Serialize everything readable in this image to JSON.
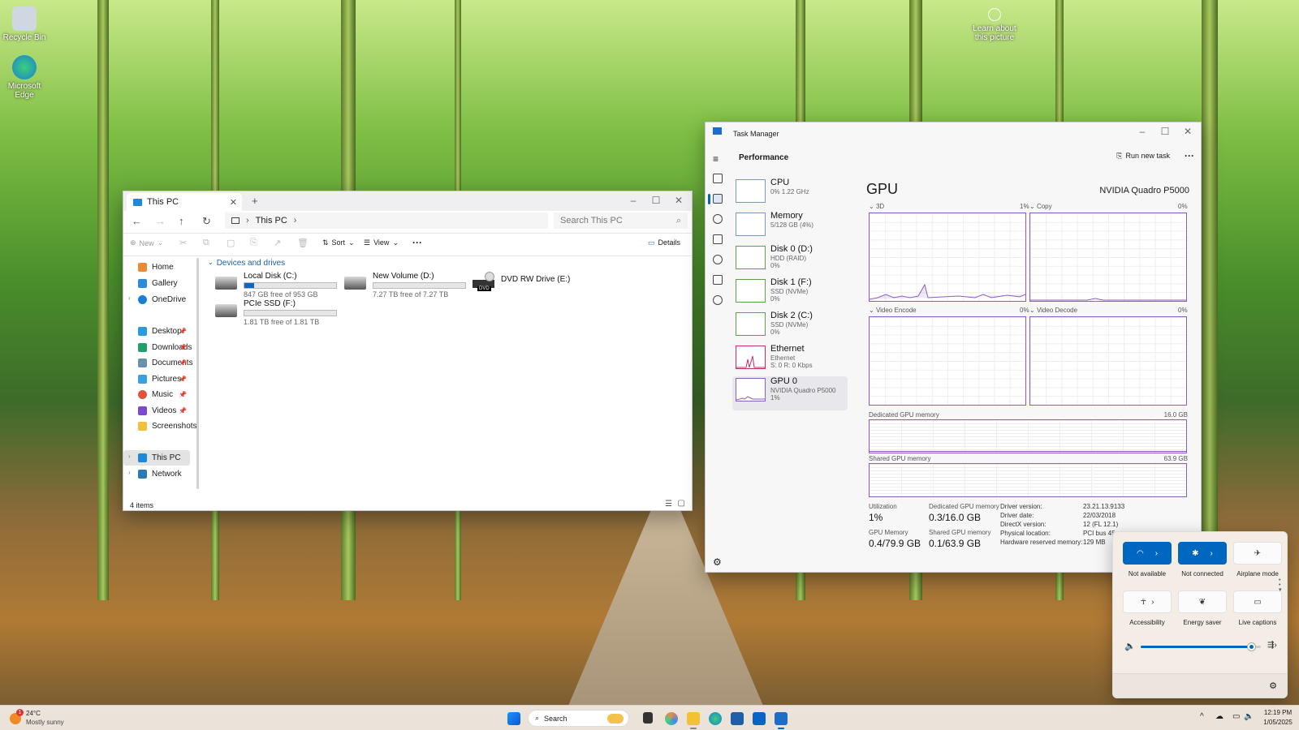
{
  "desktop": {
    "icons": [
      {
        "label": "Recycle Bin"
      },
      {
        "label": "Microsoft Edge"
      }
    ],
    "learn_label": "Learn about this picture"
  },
  "explorer": {
    "tab_title": "This PC",
    "breadcrumb": "This PC",
    "search_placeholder": "Search This PC",
    "toolbar": {
      "new": "New",
      "sort": "Sort",
      "view": "View",
      "more": "···",
      "details": "Details"
    },
    "sidebar": {
      "top": [
        {
          "label": "Home"
        },
        {
          "label": "Gallery"
        },
        {
          "label": "OneDrive"
        }
      ],
      "pinned": [
        {
          "label": "Desktop"
        },
        {
          "label": "Downloads"
        },
        {
          "label": "Documents"
        },
        {
          "label": "Pictures"
        },
        {
          "label": "Music"
        },
        {
          "label": "Videos"
        },
        {
          "label": "Screenshots"
        }
      ],
      "bottom": [
        {
          "label": "This PC"
        },
        {
          "label": "Network"
        }
      ]
    },
    "section_title": "Devices and drives",
    "drives": [
      {
        "name": "Local Disk (C:)",
        "free": "847 GB free of 953 GB",
        "used_fraction": 0.11
      },
      {
        "name": "New Volume (D:)",
        "free": "7.27 TB free of 7.27 TB",
        "used_fraction": 0.0
      },
      {
        "name": "DVD RW Drive (E:)",
        "badge": "DVD"
      },
      {
        "name": "PCIe SSD (F:)",
        "free": "1.81 TB free of 1.81 TB",
        "used_fraction": 0.0
      }
    ],
    "status": "4 items"
  },
  "taskmgr": {
    "title": "Task Manager",
    "section": "Performance",
    "run_task": "Run new task",
    "more": "···",
    "items": [
      {
        "name": "CPU",
        "l2": "0% 1.22 GHz",
        "l3": ""
      },
      {
        "name": "Memory",
        "l2": "5/128 GB (4%)",
        "l3": ""
      },
      {
        "name": "Disk 0 (D:)",
        "l2": "HDD (RAID)",
        "l3": "0%"
      },
      {
        "name": "Disk 1 (F:)",
        "l2": "SSD (NVMe)",
        "l3": "0%"
      },
      {
        "name": "Disk 2 (C:)",
        "l2": "SSD (NVMe)",
        "l3": "0%"
      },
      {
        "name": "Ethernet",
        "l2": "Ethernet",
        "l3": "S: 0 R: 0 Kbps"
      },
      {
        "name": "GPU 0",
        "l2": "NVIDIA Quadro P5000",
        "l3": "1%"
      }
    ],
    "gpu_title": "GPU",
    "gpu_model": "NVIDIA Quadro P5000",
    "graphs": [
      {
        "label": "3D",
        "pct": "1%"
      },
      {
        "label": "Copy",
        "pct": "0%"
      },
      {
        "label": "Video Encode",
        "pct": "0%"
      },
      {
        "label": "Video Decode",
        "pct": "0%"
      }
    ],
    "dedicated": {
      "label": "Dedicated GPU memory",
      "max": "16.0 GB"
    },
    "shared": {
      "label": "Shared GPU memory",
      "max": "63.9 GB"
    },
    "stats": {
      "util_l": "Utilization",
      "util_v": "1%",
      "ded_l": "Dedicated GPU memory",
      "ded_v": "0.3/16.0 GB",
      "gmem_l": "GPU Memory",
      "gmem_v": "0.4/79.9 GB",
      "sh_l": "Shared GPU memory",
      "sh_v": "0.1/63.9 GB"
    },
    "driver": [
      {
        "k": "Driver version:",
        "v": "23.21.13.9133"
      },
      {
        "k": "Driver date:",
        "v": "22/03/2018"
      },
      {
        "k": "DirectX version:",
        "v": "12 (FL 12.1)"
      },
      {
        "k": "Physical location:",
        "v": "PCI bus 45,"
      },
      {
        "k": "Hardware reserved memory:",
        "v": "129 MB"
      }
    ]
  },
  "quick_settings": {
    "tiles": [
      {
        "label": "Not available",
        "on": true
      },
      {
        "label": "Not connected",
        "on": true
      },
      {
        "label": "Airplane mode",
        "on": false
      },
      {
        "label": "Accessibility",
        "on": false
      },
      {
        "label": "Energy saver",
        "on": false
      },
      {
        "label": "Live captions",
        "on": false
      }
    ],
    "volume_fraction": 0.92
  },
  "taskbar": {
    "weather_temp": "24°C",
    "weather_desc": "Mostly sunny",
    "weather_badge": "1",
    "search": "Search",
    "time": "12:19 PM",
    "date": "1/05/2025"
  },
  "colors": {
    "accent": "#0067c0",
    "gpu_graph": "#8a5fc0",
    "eth_graph": "#c0306a"
  }
}
